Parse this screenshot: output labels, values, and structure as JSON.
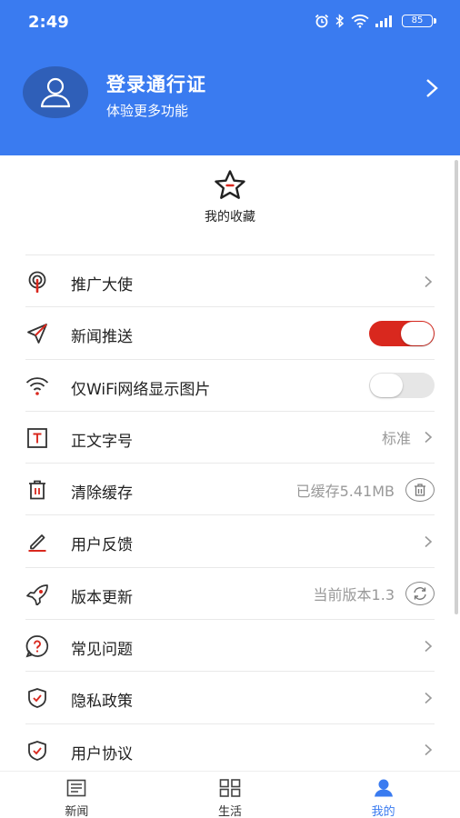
{
  "status_bar": {
    "time": "2:49",
    "battery": "85"
  },
  "profile": {
    "title": "登录通行证",
    "subtitle": "体验更多功能"
  },
  "favorites": {
    "label": "我的收藏"
  },
  "menu": [
    {
      "icon": "ambassador-icon",
      "label": "推广大使",
      "right": "chevron"
    },
    {
      "icon": "send-icon",
      "label": "新闻推送",
      "right": "toggle",
      "toggle_on": true
    },
    {
      "icon": "wifi-icon",
      "label": "仅WiFi网络显示图片",
      "right": "toggle",
      "toggle_on": false
    },
    {
      "icon": "text-size-icon",
      "label": "正文字号",
      "value": "标准",
      "right": "chevron"
    },
    {
      "icon": "trash-icon",
      "label": "清除缓存",
      "value": "已缓存5.41MB",
      "right": "trash-button"
    },
    {
      "icon": "pencil-icon",
      "label": "用户反馈",
      "right": "chevron"
    },
    {
      "icon": "rocket-icon",
      "label": "版本更新",
      "value": "当前版本1.3",
      "right": "refresh-button"
    },
    {
      "icon": "question-icon",
      "label": "常见问题",
      "right": "chevron"
    },
    {
      "icon": "shield-icon",
      "label": "隐私政策",
      "right": "chevron"
    },
    {
      "icon": "shield-icon",
      "label": "用户协议",
      "right": "chevron"
    }
  ],
  "tabbar": [
    {
      "icon": "news-icon",
      "label": "新闻",
      "active": false
    },
    {
      "icon": "grid-icon",
      "label": "生活",
      "active": false
    },
    {
      "icon": "person-icon",
      "label": "我的",
      "active": true
    }
  ],
  "colors": {
    "header_blue": "#3a7bf0",
    "toggle_red": "#d9281e",
    "accent_blue": "#3a7bf0"
  }
}
